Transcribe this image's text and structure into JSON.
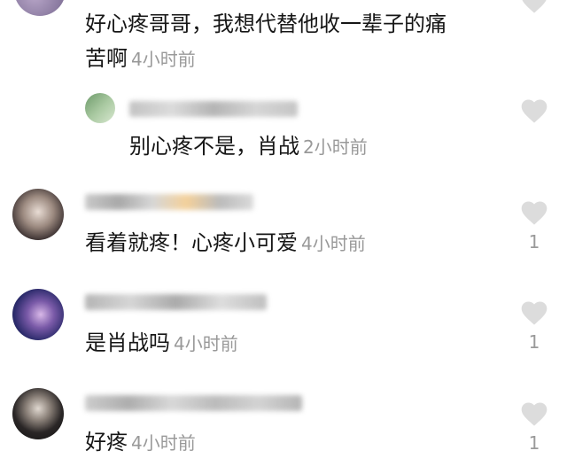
{
  "comments": [
    {
      "text_line1": "好心疼哥哥，我想代替他收一辈子的痛",
      "text_line2": "苦啊",
      "time": "4小时前",
      "likes": ""
    },
    {
      "text": "别心疼不是，肖战",
      "time": "2小时前",
      "likes": ""
    },
    {
      "text": "看着就疼！心疼小可爱",
      "time": "4小时前",
      "likes": "1"
    },
    {
      "text": "是肖战吗",
      "time": "4小时前",
      "likes": "1"
    },
    {
      "text": "好疼",
      "time": "4小时前",
      "likes": "1"
    }
  ],
  "colors": {
    "heart": "#dcdcdc",
    "time": "#999999",
    "count": "#9a9a9a"
  },
  "icons": {
    "like": "heart-icon"
  }
}
